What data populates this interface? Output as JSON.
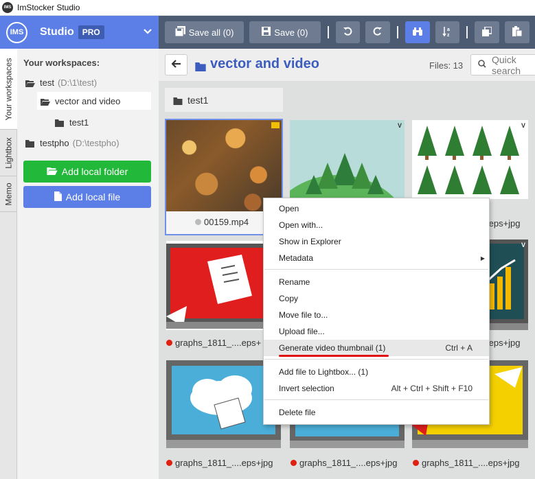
{
  "window": {
    "title": "ImStocker Studio",
    "logo": "IMS"
  },
  "brand": {
    "logo": "IMS",
    "name": "Studio",
    "badge": "PRO",
    "chevron": "chevron-down-icon"
  },
  "toolbar": {
    "save_all": "Save all (0)",
    "save": "Save (0)",
    "icons": [
      "undo-icon",
      "redo-icon",
      "binoculars-icon",
      "sort-az-icon",
      "copy-icon",
      "paste-icon"
    ]
  },
  "vtabs": [
    "Your workspaces",
    "Lightbox",
    "Memo"
  ],
  "sidebar": {
    "heading": "Your workspaces:",
    "tree": [
      {
        "label": "test",
        "path": "(D:\\1\\test)"
      },
      {
        "label": "vector and video",
        "path": ""
      },
      {
        "label": "test1",
        "path": ""
      },
      {
        "label": "testpho",
        "path": "(D:\\testpho)"
      }
    ],
    "add_folder": "Add local folder",
    "add_file": "Add local file"
  },
  "main": {
    "folder_title": "vector and video",
    "files_label": "Files: 13",
    "search_placeholder": "Quick search",
    "subfolder": "test1"
  },
  "tiles": [
    {
      "caption": "00159.mp4",
      "status_color": "#bbbbbb",
      "badge": "video-icon"
    },
    {
      "caption": "",
      "status_color": "",
      "badge": "vector-icon"
    },
    {
      "caption": ".eps+jpg",
      "status_color": "",
      "badge": "vector-icon"
    },
    {
      "caption": "graphs_1811_....eps+",
      "status_color": "#e02010",
      "badge": ""
    },
    {
      "caption": ".eps+jpg",
      "status_color": "",
      "badge": "vector-icon"
    },
    {
      "caption": "graphs_1811_....eps+jpg",
      "status_color": "#e02010",
      "badge": ""
    },
    {
      "caption": "graphs_1811_....eps+jpg",
      "status_color": "#e02010",
      "badge": ""
    },
    {
      "caption": "graphs_1811_....eps+jpg",
      "status_color": "#e02010",
      "badge": ""
    }
  ],
  "context_menu": {
    "items": [
      {
        "label": "Open",
        "shortcut": ""
      },
      {
        "label": "Open with...",
        "shortcut": ""
      },
      {
        "label": "Show in Explorer",
        "shortcut": ""
      },
      {
        "label": "Metadata",
        "shortcut": ""
      },
      {
        "label": "Rename",
        "shortcut": ""
      },
      {
        "label": "Copy",
        "shortcut": ""
      },
      {
        "label": "Move file to...",
        "shortcut": ""
      },
      {
        "label": "Upload file...",
        "shortcut": ""
      },
      {
        "label": "Generate video thumbnail (1)",
        "shortcut": "Ctrl + A"
      },
      {
        "label": "Add file to Lightbox... (1)",
        "shortcut": ""
      },
      {
        "label": "Invert selection",
        "shortcut": "Alt + Ctrl + Shift + F10"
      },
      {
        "label": "Delete file",
        "shortcut": ""
      }
    ],
    "highlight_color": "#e01010"
  }
}
